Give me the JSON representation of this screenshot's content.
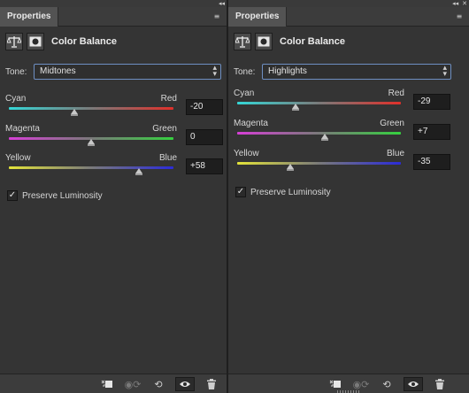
{
  "chrome": {
    "collapse_glyph": "◂◂",
    "close_glyph": "✕"
  },
  "panels": [
    {
      "tab": "Properties",
      "menu_glyph": "≡",
      "header_title": "Color Balance",
      "tone_label": "Tone:",
      "tone_value": "Midtones",
      "sliders": [
        {
          "left": "Cyan",
          "right": "Red",
          "value": "-20",
          "level": -20
        },
        {
          "left": "Magenta",
          "right": "Green",
          "value": "0",
          "level": 0
        },
        {
          "left": "Yellow",
          "right": "Blue",
          "value": "+58",
          "level": 58
        }
      ],
      "preserve_label": "Preserve Luminosity",
      "preserve_checked": true
    },
    {
      "tab": "Properties",
      "menu_glyph": "≡",
      "header_title": "Color Balance",
      "tone_label": "Tone:",
      "tone_value": "Highlights",
      "sliders": [
        {
          "left": "Cyan",
          "right": "Red",
          "value": "-29",
          "level": -29
        },
        {
          "left": "Magenta",
          "right": "Green",
          "value": "+7",
          "level": 7
        },
        {
          "left": "Yellow",
          "right": "Blue",
          "value": "-35",
          "level": -35
        }
      ],
      "preserve_label": "Preserve Luminosity",
      "preserve_checked": true
    }
  ],
  "icons": {
    "scales": "balance-scale-icon",
    "mask": "layer-mask-icon",
    "clip": "clip-to-layer-icon",
    "view_previous": "view-previous-state-icon",
    "reset": "reset-icon",
    "visibility": "eye-visibility-icon",
    "delete": "trash-icon"
  },
  "colors": {
    "cyan_red": [
      "#35d7d7",
      "#e0302a"
    ],
    "magenta_green": [
      "#d63fd6",
      "#35d13f"
    ],
    "yellow_blue": [
      "#e3e33a",
      "#2b2bd8"
    ]
  }
}
